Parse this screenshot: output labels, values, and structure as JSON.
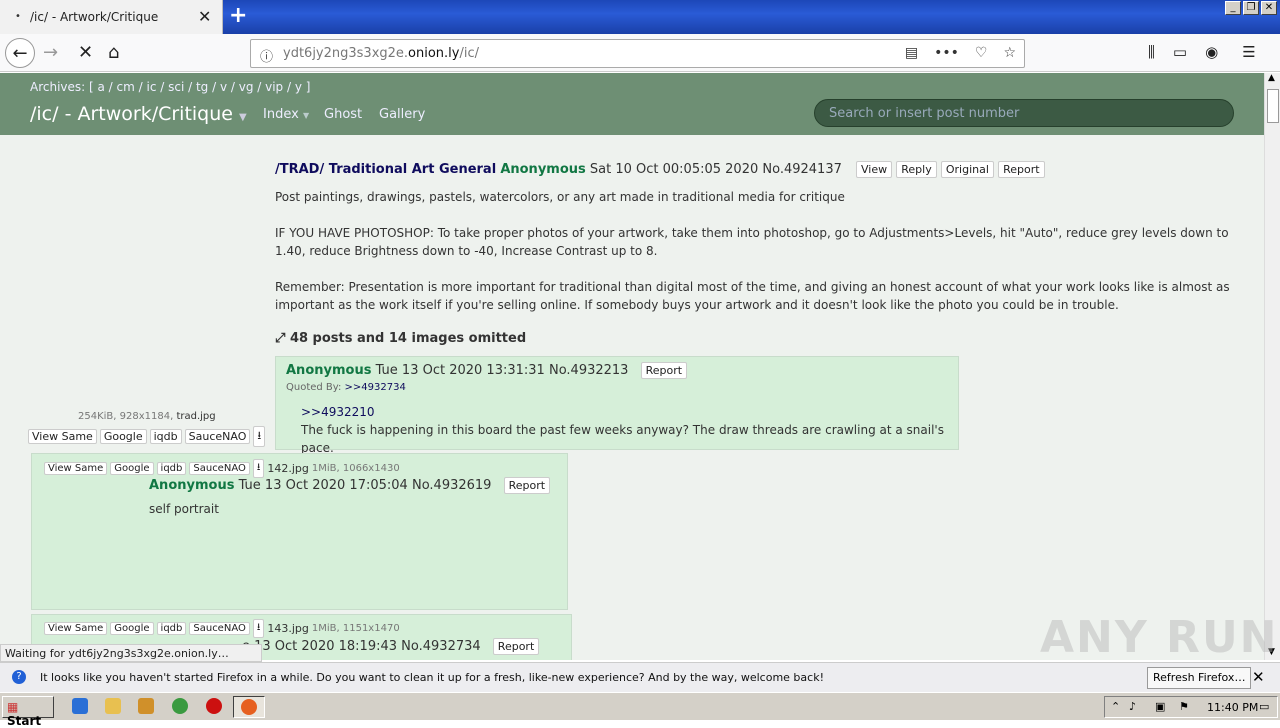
{
  "browser": {
    "tab_title": "/ic/ - Artwork/Critique",
    "url_prefix": "ydt6jy2ng3s3xg2e.",
    "url_domain": "onion.ly",
    "url_path": "/ic/",
    "status": "Waiting for ydt6jy2ng3s3xg2e.onion.ly…"
  },
  "header": {
    "archives": "Archives: [ a / cm / ic / sci / tg / v / vg / vip / y ]",
    "board_title": "/ic/ - Artwork/Critique",
    "nav_index": "Index",
    "nav_ghost": "Ghost",
    "nav_gallery": "Gallery",
    "search_placeholder": "Search or insert post number"
  },
  "op": {
    "subject": "/TRAD/ Traditional Art General",
    "name": "Anonymous",
    "date": "Sat 10 Oct 00:05:05 2020",
    "number": "No.4924137",
    "btn_view": "View",
    "btn_reply": "Reply",
    "btn_original": "Original",
    "btn_report": "Report",
    "p1": "Post paintings, drawings, pastels, watercolors, or any art made in traditional media for critique",
    "p2": "IF YOU HAVE PHOTOSHOP: To take proper photos of your artwork, take them into photoshop, go to Adjustments>Levels, hit \"Auto\", reduce grey levels down to 1.40, reduce Brightness down to -40, Increase Contrast up to 8.",
    "p3": "Remember: Presentation is more important for traditional than digital most of the time, and giving an honest account of what your work looks like is almost as important as the work itself if you're selling online. If somebody buys your artwork and it doesn't look like the photo you could be in trouble.",
    "file_meta": "254KiB, 928x1184,",
    "file_name": "trad.jpg",
    "omitted": "48 posts and 14 images omitted"
  },
  "img_buttons": {
    "view_same": "View Same",
    "google": "Google",
    "iqdb": "iqdb",
    "saucenao": "SauceNAO"
  },
  "replies": [
    {
      "name": "Anonymous",
      "date": "Tue 13 Oct 2020 13:31:31",
      "number": "No.4932213",
      "report": "Report",
      "quoted_by_label": "Quoted By:",
      "quoted_by": ">>4932734",
      "quote": ">>4932210",
      "text": "The fuck is happening in this board the past few weeks anyway? The draw threads are crawling at a snail's pace."
    },
    {
      "file_name": "142.jpg",
      "file_meta": "1MiB, 1066x1430",
      "name": "Anonymous",
      "date": "Tue 13 Oct 2020 17:05:04",
      "number": "No.4932619",
      "report": "Report",
      "text": "self portrait"
    },
    {
      "file_name": "143.jpg",
      "file_meta": "1MiB, 1151x1470",
      "date_partial": "e 13 Oct 2020 18:19:43",
      "number": "No.4932734",
      "report": "Report"
    }
  ],
  "notification": {
    "message": "It looks like you haven't started Firefox in a while. Do you want to clean it up for a fresh, like-new experience? And by the way, welcome back!",
    "refresh_label": "Refresh Firefox…"
  },
  "taskbar": {
    "start_label": "Start",
    "clock": "11:40 PM"
  },
  "watermark": "ANY RUN"
}
